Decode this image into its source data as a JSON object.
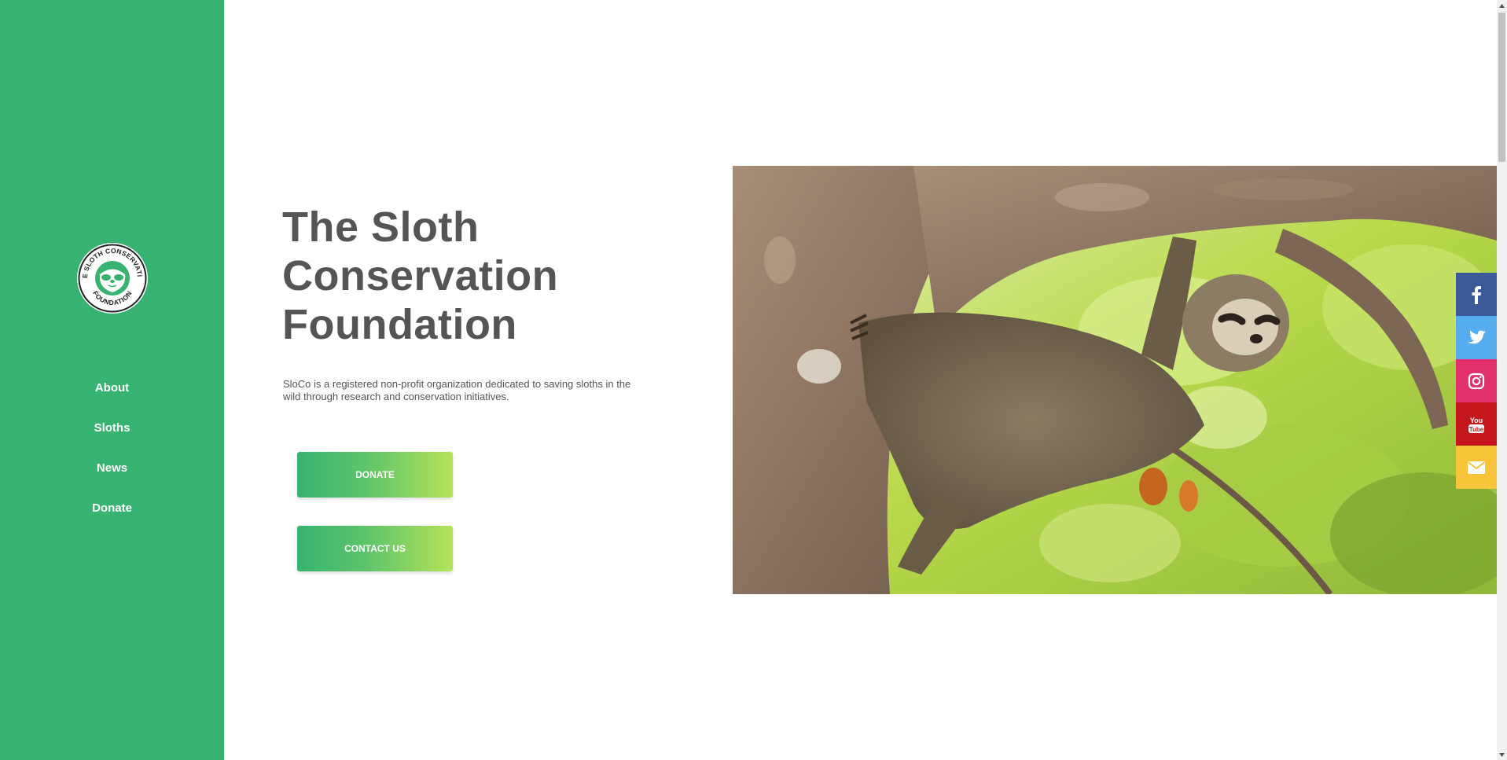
{
  "sidebar": {
    "logo": {
      "text_top": "THE SLOTH CONSERVATION",
      "text_bottom": "FOUNDATION",
      "icon": "sloth-face-icon"
    },
    "nav": [
      {
        "label": "About"
      },
      {
        "label": "Sloths"
      },
      {
        "label": "News"
      },
      {
        "label": "Donate"
      }
    ],
    "background_color": "#36b371"
  },
  "hero": {
    "title_lines": [
      "The Sloth",
      "Conservation",
      "Foundation"
    ],
    "description": "SloCo is a registered non-profit organization dedicated to saving sloths in the wild through research and conservation initiatives.",
    "donate_label": "DONATE",
    "contact_label": "CONTACT US",
    "image_icon": "sloth-in-tree-photo"
  },
  "social": [
    {
      "name": "facebook",
      "icon": "facebook-icon",
      "color": "#3b5998"
    },
    {
      "name": "twitter",
      "icon": "twitter-icon",
      "color": "#55acee"
    },
    {
      "name": "instagram",
      "icon": "instagram-icon",
      "color": "#e1306c"
    },
    {
      "name": "youtube",
      "icon": "youtube-icon",
      "color": "#c4161c"
    },
    {
      "name": "email",
      "icon": "envelope-icon",
      "color": "#f8c43a"
    }
  ]
}
